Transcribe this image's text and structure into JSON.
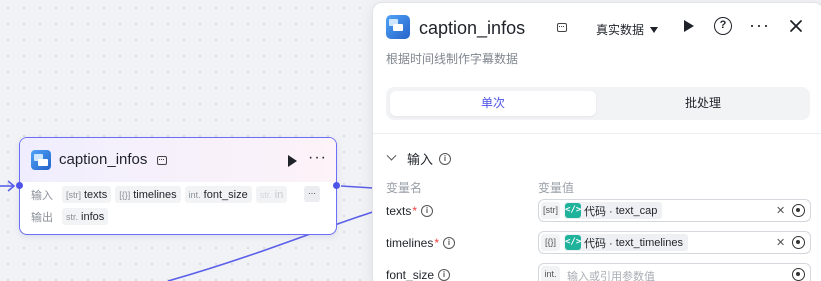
{
  "node": {
    "title": "caption_infos",
    "input_label": "输入",
    "output_label": "输出",
    "inputs": [
      {
        "type": "[str]",
        "name": "texts"
      },
      {
        "type": "[{}]",
        "name": "timelines"
      },
      {
        "type": "int.",
        "name": "font_size"
      },
      {
        "type": "str.",
        "name": "in"
      }
    ],
    "more_label": "...",
    "outputs": [
      {
        "type": "str.",
        "name": "infos"
      }
    ]
  },
  "panel": {
    "title": "caption_infos",
    "mode_label": "真实数据",
    "description": "根据时间线制作字幕数据",
    "tabs": [
      {
        "label": "单次",
        "active": true
      },
      {
        "label": "批处理",
        "active": false
      }
    ],
    "section_title": "输入",
    "col_name": "变量名",
    "col_value": "变量值",
    "params": [
      {
        "name": "texts",
        "required": true,
        "type": "[str]",
        "ref_prefix": "代码 · ",
        "ref_value": "text_cap"
      },
      {
        "name": "timelines",
        "required": true,
        "type": "[{}]",
        "ref_prefix": "代码 · ",
        "ref_value": "text_timelines"
      },
      {
        "name": "font_size",
        "required": false,
        "type": "int.",
        "placeholder": "输入或引用参数值"
      }
    ]
  },
  "icons": {
    "app": "app-cube-icon",
    "robot": "robot-icon",
    "run": "play-icon",
    "help": "help-icon",
    "more": "more-icon",
    "close": "close-icon",
    "info": "info-icon",
    "code": "code-icon",
    "clear": "clear-icon",
    "reference": "reference-target-icon"
  },
  "colors": {
    "accent": "#4d53e8",
    "node_border": "#6b6ef7",
    "code_badge": "#20b39b",
    "required": "#f53f3f"
  }
}
